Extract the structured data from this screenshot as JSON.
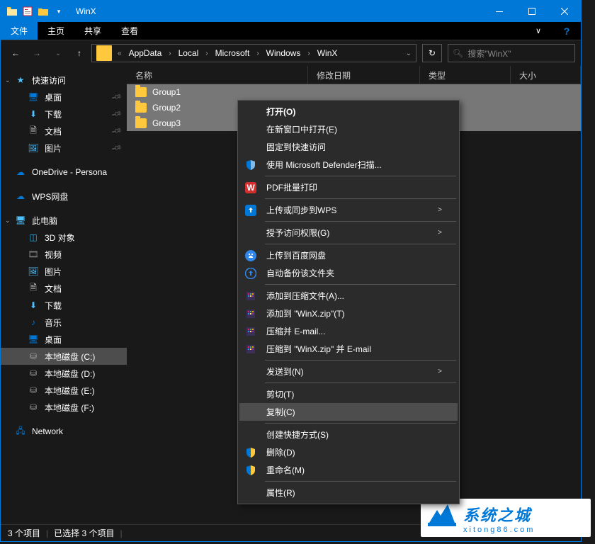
{
  "titlebar": {
    "title": "WinX"
  },
  "ribbon": {
    "file": "文件",
    "tabs": [
      "主页",
      "共享",
      "查看"
    ]
  },
  "breadcrumb": {
    "segments": [
      "AppData",
      "Local",
      "Microsoft",
      "Windows",
      "WinX"
    ]
  },
  "search": {
    "placeholder": "搜索\"WinX\""
  },
  "columns": {
    "name": "名称",
    "date": "修改日期",
    "type": "类型",
    "size": "大小"
  },
  "files": [
    {
      "name": "Group1",
      "selected": true
    },
    {
      "name": "Group2",
      "selected": true
    },
    {
      "name": "Group3",
      "selected": true
    }
  ],
  "sidebar": {
    "quick": "快速访问",
    "quick_items": [
      "桌面",
      "下载",
      "文档",
      "图片"
    ],
    "onedrive": "OneDrive - Persona",
    "wps": "WPS网盘",
    "thispc": "此电脑",
    "pc_items": [
      "3D 对象",
      "视频",
      "图片",
      "文档",
      "下载",
      "音乐",
      "桌面",
      "本地磁盘 (C:)",
      "本地磁盘 (D:)",
      "本地磁盘 (E:)",
      "本地磁盘 (F:)"
    ],
    "network": "Network"
  },
  "context_menu": [
    {
      "label": "打开(O)",
      "bold": true
    },
    {
      "label": "在新窗口中打开(E)"
    },
    {
      "label": "固定到快速访问"
    },
    {
      "label": "使用 Microsoft Defender扫描...",
      "icon": "shield"
    },
    {
      "sep": true
    },
    {
      "label": "PDF批量打印",
      "icon": "wps-red"
    },
    {
      "sep": true
    },
    {
      "label": "上传或同步到WPS",
      "icon": "wps-blue",
      "submenu": true
    },
    {
      "sep": true
    },
    {
      "label": "授予访问权限(G)",
      "submenu": true
    },
    {
      "sep": true
    },
    {
      "label": "上传到百度网盘",
      "icon": "baidu"
    },
    {
      "label": "自动备份该文件夹",
      "icon": "baidu2"
    },
    {
      "sep": true
    },
    {
      "label": "添加到压缩文件(A)...",
      "icon": "rar"
    },
    {
      "label": "添加到 \"WinX.zip\"(T)",
      "icon": "rar"
    },
    {
      "label": "压缩并 E-mail...",
      "icon": "rar"
    },
    {
      "label": "压缩到 \"WinX.zip\" 并 E-mail",
      "icon": "rar"
    },
    {
      "sep": true
    },
    {
      "label": "发送到(N)",
      "submenu": true
    },
    {
      "sep": true
    },
    {
      "label": "剪切(T)"
    },
    {
      "label": "复制(C)",
      "hover": true
    },
    {
      "sep": true
    },
    {
      "label": "创建快捷方式(S)"
    },
    {
      "label": "删除(D)",
      "icon": "uac"
    },
    {
      "label": "重命名(M)",
      "icon": "uac"
    },
    {
      "sep": true
    },
    {
      "label": "属性(R)"
    }
  ],
  "statusbar": {
    "count": "3 个项目",
    "selected": "已选择 3 个项目"
  },
  "watermark": {
    "title": "系统之城",
    "sub": "xitong86.com"
  }
}
